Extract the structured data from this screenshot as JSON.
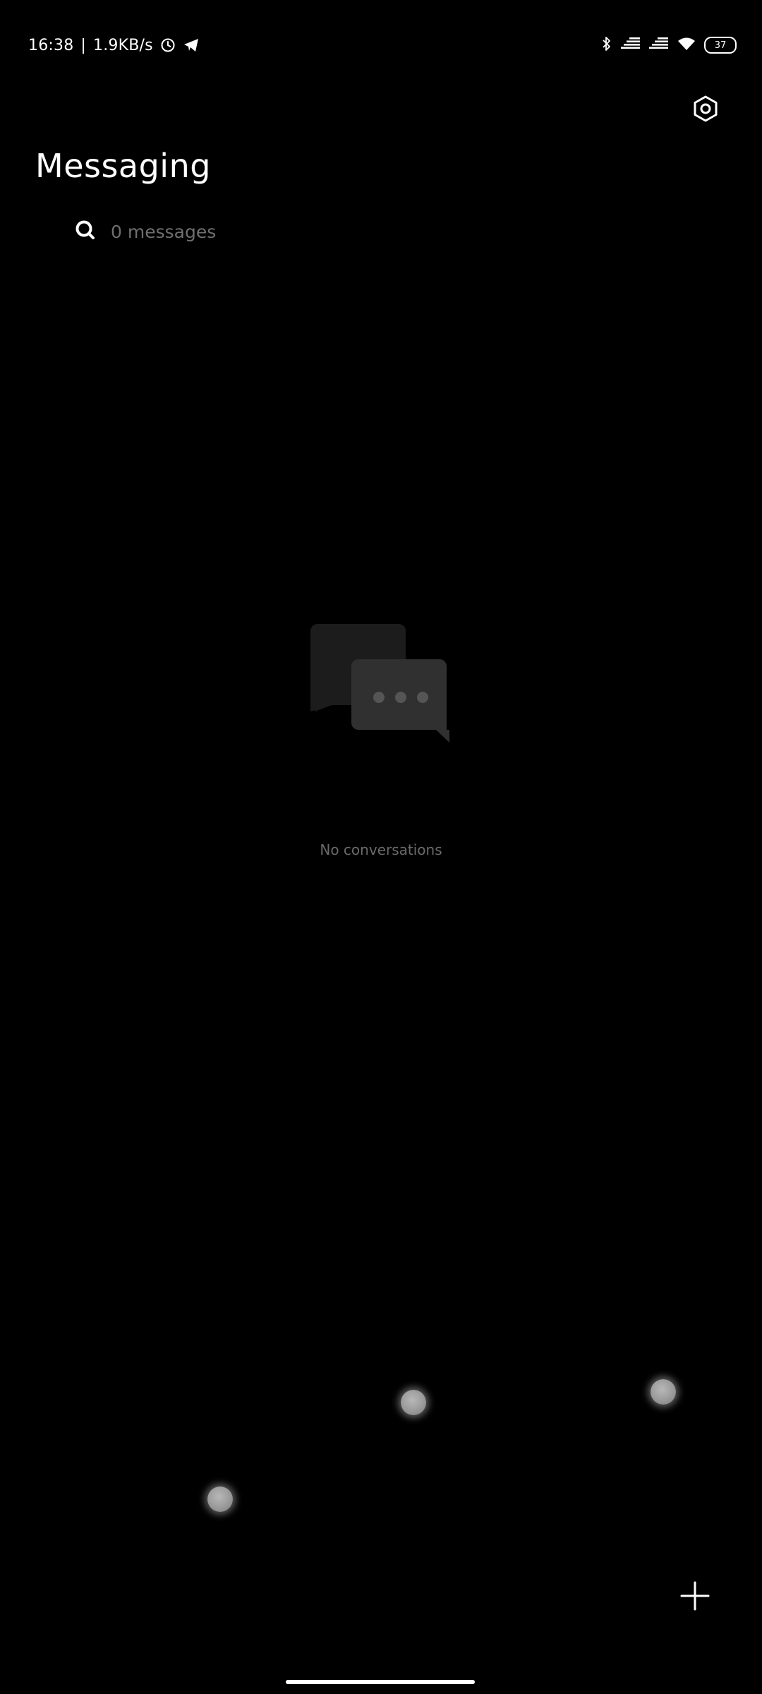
{
  "status_bar": {
    "time": "16:38",
    "separator": "|",
    "network_speed": "1.9KB/s",
    "left_icons": [
      "alarm-icon",
      "telegram-icon"
    ],
    "right_icons": [
      "bluetooth-icon",
      "signal-icon",
      "signal-icon",
      "wifi-icon",
      "battery-icon"
    ],
    "battery_level": "37"
  },
  "header": {
    "title": "Messaging",
    "settings_icon": "settings-icon"
  },
  "search": {
    "icon": "search-icon",
    "label": "0 messages"
  },
  "empty_state": {
    "icon": "chat-bubbles-icon",
    "message": "No conversations"
  },
  "fab": {
    "icon": "plus-icon"
  },
  "colors": {
    "background": "#000000",
    "text_primary": "#ffffff",
    "text_secondary": "#6f6f6f"
  }
}
